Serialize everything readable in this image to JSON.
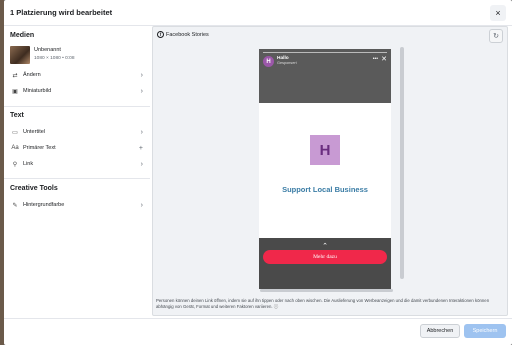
{
  "modal": {
    "title": "1 Platzierung wird bearbeitet",
    "close_icon": "×"
  },
  "left_panel": {
    "media_section": "Medien",
    "media_name": "Unbenannt",
    "media_meta": "1080 × 1080 • 0:08",
    "media_rows": [
      {
        "icon": "swap-icon",
        "glyph": "⇄",
        "label": "Ändern",
        "action": "›"
      },
      {
        "icon": "image-icon",
        "glyph": "▣",
        "label": "Miniaturbild",
        "action": "›"
      }
    ],
    "text_section": "Text",
    "text_rows": [
      {
        "icon": "subtitles-icon",
        "glyph": "▭",
        "label": "Untertitel",
        "action": "›"
      },
      {
        "icon": "text-icon",
        "glyph": "Aa",
        "label": "Primärer Text",
        "action": "+"
      },
      {
        "icon": "link-icon",
        "glyph": "⚲",
        "label": "Link",
        "action": "›"
      }
    ],
    "creative_section": "Creative Tools",
    "creative_rows": [
      {
        "icon": "paint-icon",
        "glyph": "✎",
        "label": "Hintergrundfarbe",
        "action": "›"
      }
    ]
  },
  "preview": {
    "platform_label": "Facebook Stories",
    "platform_icon": "f",
    "refresh_icon": "↻",
    "story": {
      "avatar_letter": "H",
      "page_name": "Hallo",
      "sponsored": "Gesponsert",
      "more_icon": "•••",
      "close_icon": "✕",
      "logo_letter": "H",
      "headline": "Support Local Business",
      "swipe_icon": "⌃",
      "cta_label": "Mehr dazu"
    }
  },
  "disclaimer": {
    "text": "Personen können deinen Link öffnen, indem sie auf ihn tippen oder nach oben wischen. Die Auslieferung von Werbeanzeigen und die damit verbundenen Interaktionen können abhängig von Gerät, Format und weiteren Faktoren variieren.",
    "info_icon": "ⓘ"
  },
  "footer": {
    "cancel_label": "Abbrechen",
    "save_label": "Speichern"
  },
  "colors": {
    "accent": "#1877f2",
    "save_disabled": "#9ec3f0",
    "cta": "#f0284a",
    "logo_bg": "#c89ad3",
    "headline": "#3a7ca5"
  }
}
